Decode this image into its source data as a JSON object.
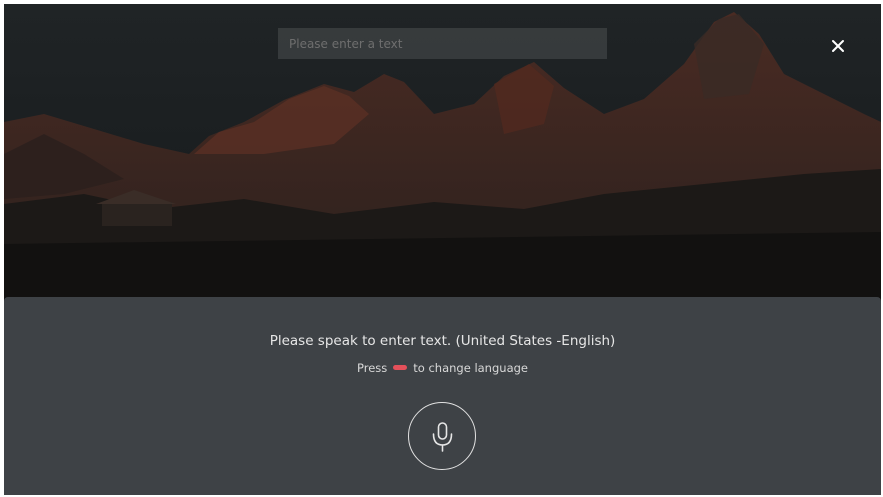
{
  "search": {
    "placeholder": "Please enter a text",
    "value": ""
  },
  "close_button": {
    "icon": "close-icon"
  },
  "voice_panel": {
    "prompt": "Please speak to enter text. (United States -English)",
    "hint_before": "Press",
    "hint_key_color": "#e4505a",
    "hint_after": "to change language",
    "mic_icon": "microphone-icon"
  },
  "colors": {
    "panel_background": "#3e4246",
    "red_button": "#e4505a"
  }
}
